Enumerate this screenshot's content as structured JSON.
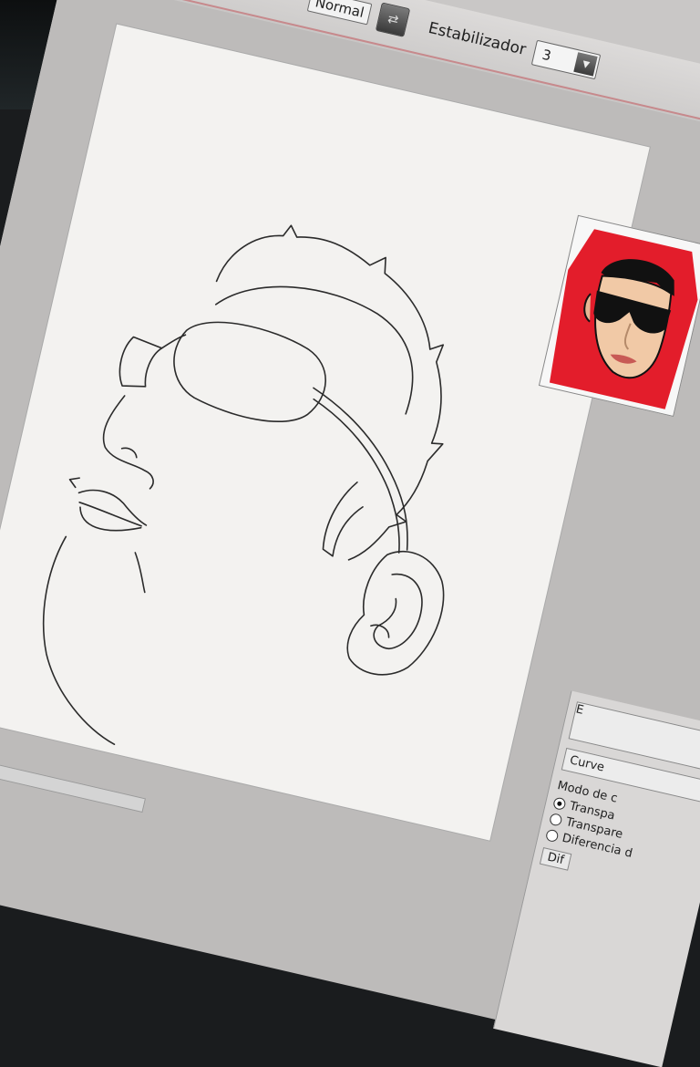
{
  "toolbar": {
    "blend_mode": "Normal",
    "stabilizer_label": "Estabilizador",
    "stabilizer_value": "3"
  },
  "right_panel": {
    "field_top": "E",
    "curve_label": "Curve",
    "mode_label": "Modo de c",
    "options": [
      "Transpa",
      "Transpare",
      "Diferencia d"
    ],
    "selected_option": 0,
    "button_label": "Dif"
  },
  "colors": {
    "preview_bg": "#e31d2b",
    "toolbar_rule": "#c7898c",
    "canvas": "#f3f2f0"
  },
  "icons": {
    "swap": "swap-colors-icon",
    "dropdown": "dropdown-arrow-icon"
  }
}
